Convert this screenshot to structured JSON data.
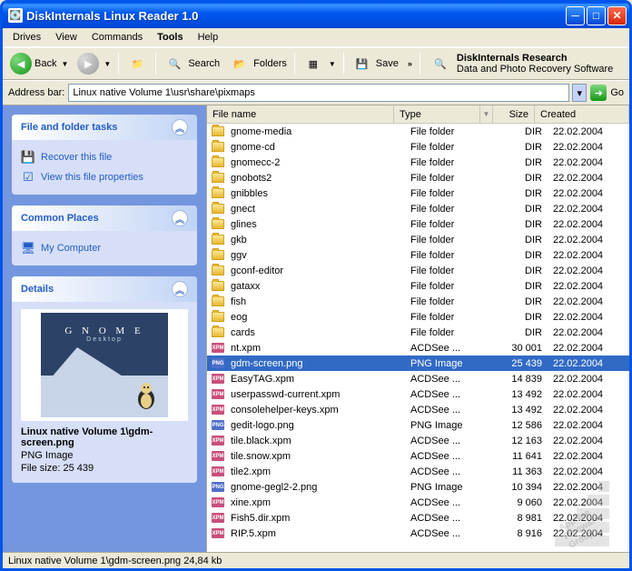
{
  "window": {
    "title": "DiskInternals Linux Reader 1.0"
  },
  "menu": {
    "items": [
      "Drives",
      "View",
      "Commands",
      "Tools",
      "Help"
    ],
    "bold_index": 3
  },
  "toolbar": {
    "back": "Back",
    "search": "Search",
    "folders": "Folders",
    "save": "Save",
    "research_title": "DiskInternals Research",
    "research_sub": "Data and Photo Recovery Software"
  },
  "addressbar": {
    "label": "Address bar:",
    "path": "Linux native Volume 1\\usr\\share\\pixmaps",
    "go": "Go"
  },
  "sidepanel": {
    "tasks_header": "File and folder tasks",
    "task_recover": "Recover this file",
    "task_properties": "View this file properties",
    "places_header": "Common Places",
    "place_mycomputer": "My Computer",
    "details_header": "Details",
    "details_path": "Linux native Volume 1\\gdm-screen.png",
    "details_type": "PNG Image",
    "details_size": "File size: 25 439"
  },
  "columns": {
    "name": "File name",
    "type": "Type",
    "size": "Size",
    "created": "Created"
  },
  "files": [
    {
      "name": "gnome-media",
      "type": "File folder",
      "size": "DIR",
      "created": "22.02.2004",
      "icon": "folder"
    },
    {
      "name": "gnome-cd",
      "type": "File folder",
      "size": "DIR",
      "created": "22.02.2004",
      "icon": "folder"
    },
    {
      "name": "gnomecc-2",
      "type": "File folder",
      "size": "DIR",
      "created": "22.02.2004",
      "icon": "folder"
    },
    {
      "name": "gnobots2",
      "type": "File folder",
      "size": "DIR",
      "created": "22.02.2004",
      "icon": "folder"
    },
    {
      "name": "gnibbles",
      "type": "File folder",
      "size": "DIR",
      "created": "22.02.2004",
      "icon": "folder"
    },
    {
      "name": "gnect",
      "type": "File folder",
      "size": "DIR",
      "created": "22.02.2004",
      "icon": "folder"
    },
    {
      "name": "glines",
      "type": "File folder",
      "size": "DIR",
      "created": "22.02.2004",
      "icon": "folder"
    },
    {
      "name": "gkb",
      "type": "File folder",
      "size": "DIR",
      "created": "22.02.2004",
      "icon": "folder"
    },
    {
      "name": "ggv",
      "type": "File folder",
      "size": "DIR",
      "created": "22.02.2004",
      "icon": "folder"
    },
    {
      "name": "gconf-editor",
      "type": "File folder",
      "size": "DIR",
      "created": "22.02.2004",
      "icon": "folder"
    },
    {
      "name": "gataxx",
      "type": "File folder",
      "size": "DIR",
      "created": "22.02.2004",
      "icon": "folder"
    },
    {
      "name": "fish",
      "type": "File folder",
      "size": "DIR",
      "created": "22.02.2004",
      "icon": "folder"
    },
    {
      "name": "eog",
      "type": "File folder",
      "size": "DIR",
      "created": "22.02.2004",
      "icon": "folder"
    },
    {
      "name": "cards",
      "type": "File folder",
      "size": "DIR",
      "created": "22.02.2004",
      "icon": "folder"
    },
    {
      "name": "nt.xpm",
      "type": "ACDSee ...",
      "size": "30 001",
      "created": "22.02.2004",
      "icon": "xpm"
    },
    {
      "name": "gdm-screen.png",
      "type": "PNG Image",
      "size": "25 439",
      "created": "22.02.2004",
      "icon": "png",
      "selected": true
    },
    {
      "name": "EasyTAG.xpm",
      "type": "ACDSee ...",
      "size": "14 839",
      "created": "22.02.2004",
      "icon": "xpm"
    },
    {
      "name": "userpasswd-current.xpm",
      "type": "ACDSee ...",
      "size": "13 492",
      "created": "22.02.2004",
      "icon": "xpm"
    },
    {
      "name": "consolehelper-keys.xpm",
      "type": "ACDSee ...",
      "size": "13 492",
      "created": "22.02.2004",
      "icon": "xpm"
    },
    {
      "name": "gedit-logo.png",
      "type": "PNG Image",
      "size": "12 586",
      "created": "22.02.2004",
      "icon": "png"
    },
    {
      "name": "tile.black.xpm",
      "type": "ACDSee ...",
      "size": "12 163",
      "created": "22.02.2004",
      "icon": "xpm"
    },
    {
      "name": "tile.snow.xpm",
      "type": "ACDSee ...",
      "size": "11 641",
      "created": "22.02.2004",
      "icon": "xpm"
    },
    {
      "name": "tile2.xpm",
      "type": "ACDSee ...",
      "size": "11 363",
      "created": "22.02.2004",
      "icon": "xpm"
    },
    {
      "name": "gnome-gegl2-2.png",
      "type": "PNG Image",
      "size": "10 394",
      "created": "22.02.2004",
      "icon": "png"
    },
    {
      "name": "xine.xpm",
      "type": "ACDSee ...",
      "size": "9 060",
      "created": "22.02.2004",
      "icon": "xpm"
    },
    {
      "name": "Fish5.dir.xpm",
      "type": "ACDSee ...",
      "size": "8 981",
      "created": "22.02.2004",
      "icon": "xpm"
    },
    {
      "name": "RIP.5.xpm",
      "type": "ACDSee ...",
      "size": "8 916",
      "created": "22.02.2004",
      "icon": "xpm"
    }
  ],
  "statusbar": {
    "text": "Linux native Volume 1\\gdm-screen.png 24,84 kb"
  }
}
